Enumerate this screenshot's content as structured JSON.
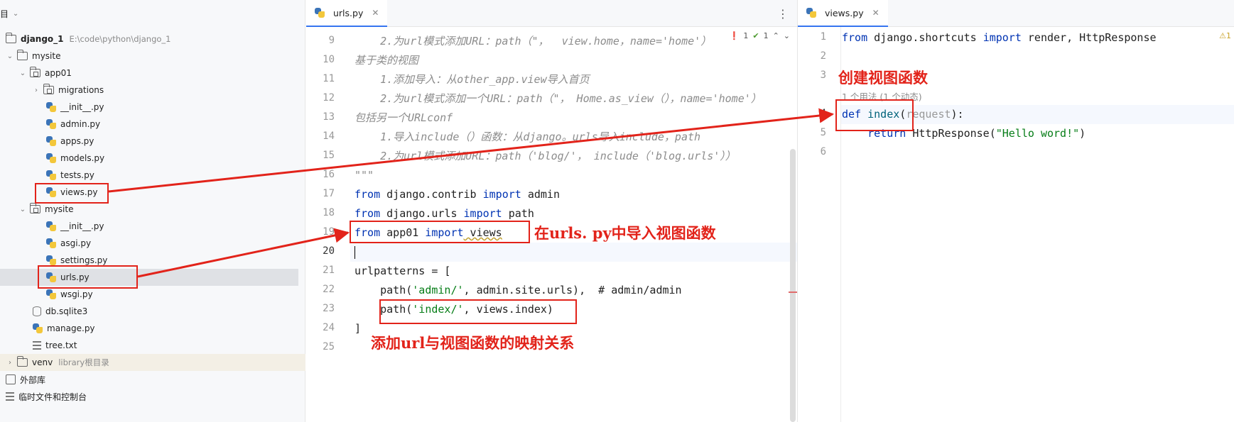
{
  "project_panel": {
    "title": "目",
    "items": [
      {
        "label": "django_1",
        "hint": "E:\\code\\python\\django_1",
        "type": "folder"
      },
      {
        "label": "mysite",
        "type": "folder"
      },
      {
        "label": "app01",
        "type": "package"
      },
      {
        "label": "migrations",
        "type": "package"
      },
      {
        "label": "__init__.py",
        "type": "python"
      },
      {
        "label": "admin.py",
        "type": "python"
      },
      {
        "label": "apps.py",
        "type": "python"
      },
      {
        "label": "models.py",
        "type": "python"
      },
      {
        "label": "tests.py",
        "type": "python"
      },
      {
        "label": "views.py",
        "type": "python"
      },
      {
        "label": "mysite",
        "type": "package"
      },
      {
        "label": "__init__.py",
        "type": "python"
      },
      {
        "label": "asgi.py",
        "type": "python"
      },
      {
        "label": "settings.py",
        "type": "python"
      },
      {
        "label": "urls.py",
        "type": "python"
      },
      {
        "label": "wsgi.py",
        "type": "python"
      },
      {
        "label": "db.sqlite3",
        "type": "db"
      },
      {
        "label": "manage.py",
        "type": "python"
      },
      {
        "label": "tree.txt",
        "type": "text"
      },
      {
        "label": "venv",
        "hint": "library根目录",
        "type": "folder"
      },
      {
        "label": "外部库",
        "type": "library"
      },
      {
        "label": "临时文件和控制台",
        "type": "scratch"
      }
    ]
  },
  "editor_left": {
    "tab_label": "urls.py",
    "inspections": {
      "errors": "1",
      "ok": "1"
    },
    "line_numbers": [
      "9",
      "10",
      "11",
      "12",
      "13",
      "14",
      "15",
      "16",
      "17",
      "18",
      "19",
      "20",
      "21",
      "22",
      "23",
      "24",
      "25"
    ],
    "lines": [
      {
        "t1": "    2.为url模式添加URL：path（\"，  view.home，name='home'）"
      },
      {
        "t1": "基于类的视图"
      },
      {
        "t1": "    1.添加导入：从other_app.view导入首页"
      },
      {
        "t1": "    2.为url模式添加一个URL：path（\"， Home.as_view（），name='home'）"
      },
      {
        "t1": "包括另一个URLconf"
      },
      {
        "t1": "    1.导入include（）函数：从django。urls导入include，path"
      },
      {
        "t1": "    2.为url模式添加URL：path（'blog/'， include（'blog.urls'））"
      },
      {
        "t1": "\"\"\""
      },
      {
        "kw1": "from",
        "t1": " django.contrib ",
        "kw2": "import",
        "t2": " admin"
      },
      {
        "kw1": "from",
        "t1": " django.urls ",
        "kw2": "import",
        "t2": " path"
      },
      {
        "kw1": "from",
        "t1": " app01 ",
        "kw2": "import",
        "t2": " views"
      },
      {
        "t1": ""
      },
      {
        "t1": "urlpatterns = ["
      },
      {
        "t1": "    path(",
        "s1": "'admin/'",
        "t2": ", admin.site.urls),  # admin/admin"
      },
      {
        "t1": "    path(",
        "s1": "'index/'",
        "t2": ", views.index)"
      },
      {
        "t1": "]"
      },
      {
        "t1": ""
      }
    ]
  },
  "editor_right": {
    "tab_label": "views.py",
    "warning": "⚠1",
    "line_numbers": [
      "1",
      "2",
      "3",
      "4",
      "5",
      "6"
    ],
    "line1": {
      "kw1": "from",
      "t1": " django.shortcuts ",
      "kw2": "import",
      "t2": " render, HttpResponse"
    },
    "inlay": "1 个用法 (1 个动态)",
    "line4": {
      "kw": "def",
      "fn": "index",
      "p": "request",
      "rest": "):"
    },
    "line5": {
      "kw": "    return",
      "t1": " HttpResponse(",
      "s1": "\"Hello word!\"",
      "t2": ")"
    }
  },
  "annotations": {
    "import_views": "在urls. py中导入视图函数",
    "add_mapping": "添加url与视图函数的映射关系",
    "create_view": "创建视图函数"
  },
  "colors": {
    "accent": "#3574f0",
    "annotation": "#e2231a",
    "keyword": "#0033b3",
    "string": "#067d17"
  }
}
